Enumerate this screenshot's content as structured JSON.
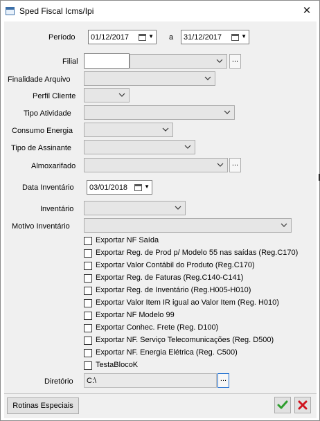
{
  "window": {
    "title": "Sped Fiscal Icms/Ipi",
    "close_glyph": "✕"
  },
  "form": {
    "periodo_label": "Período",
    "periodo_start": "01/12/2017",
    "periodo_sep": "a",
    "periodo_end": "31/12/2017",
    "filial_label": "Filial",
    "filial_code": "",
    "filial_value": "",
    "finalidade_label": "Finalidade Arquivo",
    "finalidade_value": "",
    "perfil_label": "Perfil Cliente",
    "perfil_value": "",
    "atividade_label": "Tipo Atividade",
    "atividade_value": "",
    "energia_label": "Consumo Energia",
    "energia_value": "",
    "assinante_label": "Tipo de Assinante",
    "assinante_value": "",
    "almox_label": "Almoxarifado",
    "almox_value": "",
    "data_inv_label": "Data Inventário",
    "data_inv_value": "03/01/2018",
    "inventario_label": "Inventário",
    "inventario_value": "",
    "motivo_label": "Motivo Inventário",
    "motivo_value": "",
    "ellipsis": "...",
    "diretorio_label": "Diretório",
    "diretorio_value": "C:\\"
  },
  "checkboxes": [
    {
      "label": "Exportar NF Saída",
      "checked": false
    },
    {
      "label": "Exportar Reg. de Prod p/ Modelo 55 nas saídas (Reg.C170)",
      "checked": false
    },
    {
      "label": "Exportar Valor Contábil do Produto (Reg.C170)",
      "checked": false
    },
    {
      "label": "Exportar Reg. de Faturas (Reg.C140-C141)",
      "checked": false
    },
    {
      "label": "Exportar Reg. de Inventário (Reg.H005-H010)",
      "checked": false
    },
    {
      "label": "Exportar Valor Item IR igual ao Valor Item (Reg. H010)",
      "checked": false
    },
    {
      "label": "Exportar NF Modelo 99",
      "checked": false
    },
    {
      "label": "Exportar Conhec. Frete (Reg. D100)",
      "checked": false
    },
    {
      "label": "Exportar NF. Serviço Telecomunicações (Reg. D500)",
      "checked": false
    },
    {
      "label": "Exportar NF. Energia Elétrica (Reg. C500)",
      "checked": false
    },
    {
      "label": "TestaBlocoK",
      "checked": false
    }
  ],
  "footer": {
    "rotinas_label": "Rotinas Especiais",
    "ok_icon": "check-icon",
    "cancel_icon": "x-icon"
  },
  "colors": {
    "ok_green": "#2e9e2e",
    "cancel_red": "#d0141e",
    "focus_blue": "#1f6fd0"
  }
}
